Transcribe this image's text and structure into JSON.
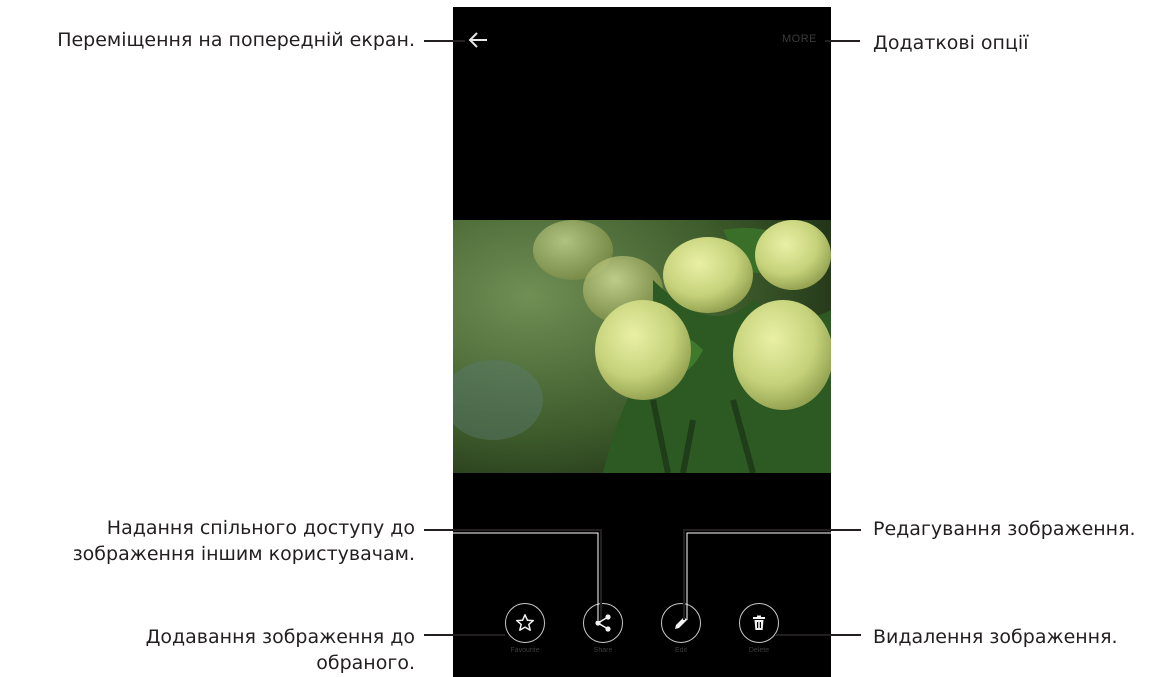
{
  "annotations": {
    "back": "Переміщення на попередній екран.",
    "more": "Додаткові опції",
    "share_line1": "Надання спільного доступу до",
    "share_line2": "зображення іншим користувачам.",
    "edit": "Редагування зображення.",
    "favourite_line1": "Додавання зображення до",
    "favourite_line2": "обраного.",
    "delete": "Видалення зображення."
  },
  "screen": {
    "more_label": "MORE",
    "actions": [
      {
        "label": "Favourite",
        "icon": "star-icon"
      },
      {
        "label": "Share",
        "icon": "share-icon"
      },
      {
        "label": "Edit",
        "icon": "pencil-icon"
      },
      {
        "label": "Delete",
        "icon": "trash-icon"
      }
    ]
  },
  "colors": {
    "screen_bg": "#000000",
    "callout_line": "#231f20",
    "text": "#231f20"
  }
}
